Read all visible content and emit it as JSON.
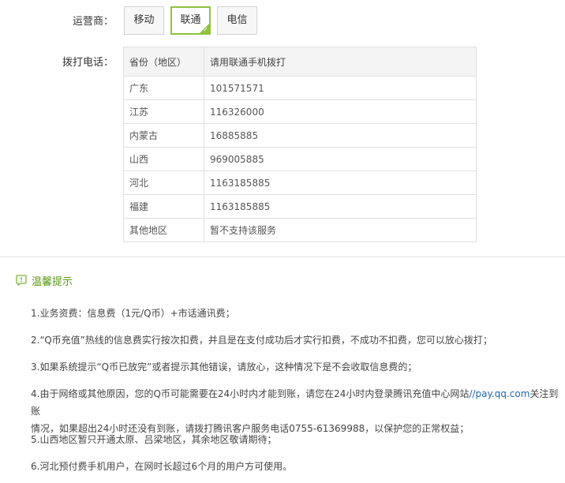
{
  "carrier": {
    "label": "运营商：",
    "options": [
      "移动",
      "联通",
      "电信"
    ],
    "selected": "联通"
  },
  "phone": {
    "label": "拨打电话：",
    "columns": [
      "省份（地区）",
      "请用联通手机拨打"
    ],
    "rows": [
      [
        "广东",
        "101571571"
      ],
      [
        "江苏",
        "116326000"
      ],
      [
        "内蒙古",
        "16885885"
      ],
      [
        "山西",
        "969005885"
      ],
      [
        "河北",
        "1163185885"
      ],
      [
        "福建",
        "1163185885"
      ],
      [
        "其他地区",
        "暂不支持该服务"
      ]
    ]
  },
  "tips": {
    "title": "温馨提示",
    "items": [
      "1.业务资费：信息费（1元/Q币）+市话通讯费；",
      "2.“Q币充值”热线的信息费实行按次扣费，并且是在支付成功后才实行扣费，不成功不扣费，您可以放心拨打；",
      "3.如果系统提示“Q币已放完”或者提示其他错误，请放心，这种情况下是不会收取信息费的；",
      "4b_placeholder",
      "5.山西地区暂只开通太原、吕梁地区，其余地区敬请期待；",
      "6.河北预付费手机用户，在网时长超过6个月的用户方可使用。"
    ],
    "item4_pre": "4.由于网络或其他原因，您的Q币可能需要在24小时内才能到账，请您在24小时内登录腾讯充值中心网站",
    "item4_link": "//pay.qq.com",
    "item4_line1_post": "关注到账",
    "item4_line2": "情况，如果超出24小时还没有到账，请拨打腾讯客户服务电话0755-61369988，以保护您的正常权益；"
  },
  "colors": {
    "accent": "#8fc23f",
    "tip_title": "#5a9a1a",
    "link": "#1f64b4"
  }
}
